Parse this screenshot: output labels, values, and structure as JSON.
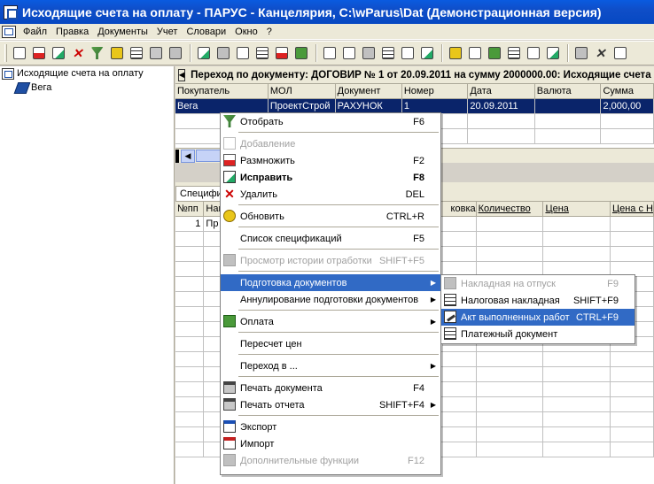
{
  "window": {
    "title": "Исходящие счета на оплату - ПАРУС - Канцелярия, C:\\wParus\\Dat (Демонстрационная версия)"
  },
  "menubar": [
    "Файл",
    "Правка",
    "Документы",
    "Учет",
    "Словари",
    "Окно",
    "?"
  ],
  "tree": {
    "root": "Исходящие счета на оплату",
    "child": "Вега"
  },
  "navigation": {
    "header": "Переход по документу: ДОГОВИР № 1 от 20.09.2011 на сумму 2000000.00: Исходящие счета н"
  },
  "documents_grid": {
    "columns": [
      "Покупатель",
      "МОЛ",
      "Документ",
      "Номер",
      "Дата",
      "Валюта",
      "Сумма"
    ],
    "rows": [
      [
        "Вега",
        "ПроектСтрой",
        "РАХУНОК",
        "1",
        "20.09.2011",
        "",
        "2,000,00"
      ]
    ]
  },
  "spec_tab": "Специфи",
  "spec_grid": {
    "columns": [
      "№пп",
      "Наи",
      "",
      "",
      "ковка",
      "Количество",
      "Цена",
      "Цена с Н"
    ],
    "rows": [
      [
        "1",
        "Пр",
        "",
        "",
        "",
        "",
        "",
        ""
      ]
    ]
  },
  "context_menu": {
    "filter": {
      "label": "Отобрать",
      "shortcut": "F6"
    },
    "add": {
      "label": "Добавление",
      "shortcut": ""
    },
    "clone": {
      "label": "Размножить",
      "shortcut": "F2"
    },
    "edit": {
      "label": "Исправить",
      "shortcut": "F8"
    },
    "delete": {
      "label": "Удалить",
      "shortcut": "DEL"
    },
    "refresh": {
      "label": "Обновить",
      "shortcut": "CTRL+R"
    },
    "spec_list": {
      "label": "Список спецификаций",
      "shortcut": "F5"
    },
    "history": {
      "label": "Просмотр истории отработки",
      "shortcut": "SHIFT+F5"
    },
    "prepare_docs": {
      "label": "Подготовка документов"
    },
    "cancel_prep": {
      "label": "Аннулирование подготовки документов"
    },
    "payment": {
      "label": "Оплата"
    },
    "recalc": {
      "label": "Пересчет цен"
    },
    "goto": {
      "label": "Переход в ..."
    },
    "print_doc": {
      "label": "Печать документа",
      "shortcut": "F4"
    },
    "print_report": {
      "label": "Печать отчета",
      "shortcut": "SHIFT+F4"
    },
    "export": {
      "label": "Экспорт"
    },
    "import": {
      "label": "Импорт"
    },
    "extra": {
      "label": "Дополнительные функции",
      "shortcut": "F12"
    }
  },
  "submenu": {
    "waybill": {
      "label": "Накладная на отпуск",
      "shortcut": "F9"
    },
    "tax_invoice": {
      "label": "Налоговая накладная",
      "shortcut": "SHIFT+F9"
    },
    "act": {
      "label": "Акт выполненных работ",
      "shortcut": "CTRL+F9"
    },
    "payment_doc": {
      "label": "Платежный документ",
      "shortcut": ""
    }
  },
  "colors": {
    "titlebar": "#0a5be0",
    "selection": "#0a246a",
    "menu_highlight": "#316ac5"
  }
}
